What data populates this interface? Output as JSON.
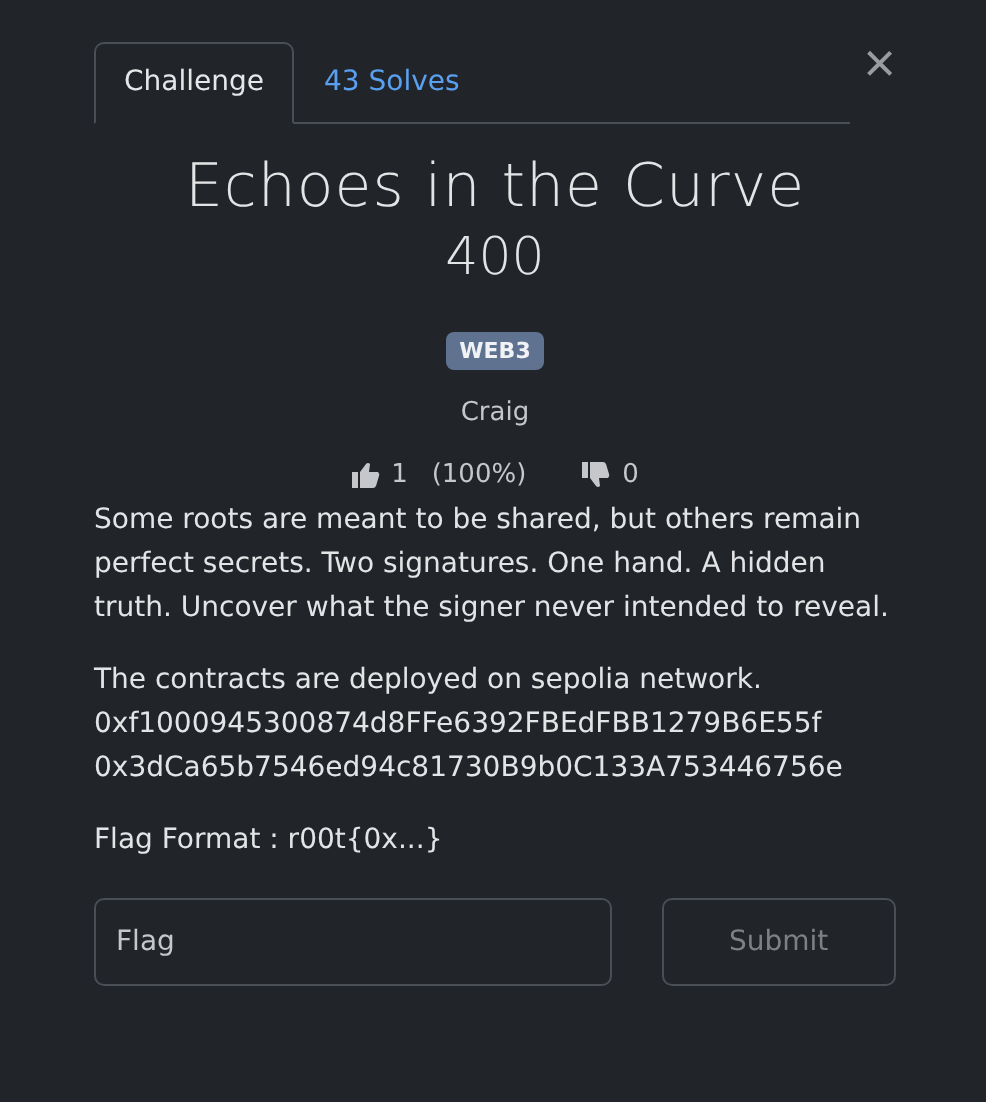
{
  "tabs": [
    {
      "label": "Challenge",
      "selected": true
    },
    {
      "label": "43 Solves",
      "selected": false
    }
  ],
  "close": "×",
  "title": "Echoes in the Curve",
  "points": "400",
  "tag": "WEB3",
  "author": "Craig",
  "rating": {
    "likes": "1",
    "percent": "(100%)",
    "dislikes": "0"
  },
  "description": [
    "Some roots are meant to be shared, but others remain perfect secrets. Two signatures. One hand. A hidden truth. Uncover what the signer never intended to reveal.",
    "The contracts are deployed on sepolia network.\n0xf1000945300874d8FFe6392FBEdFBB1279B6E55f\n0x3dCa65b7546ed94c81730B9b0C133A753446756e",
    "Flag Format : r00t{0x...}"
  ],
  "flag_field": {
    "placeholder": "Flag"
  },
  "submit": {
    "label": "Submit",
    "disabled": true
  }
}
